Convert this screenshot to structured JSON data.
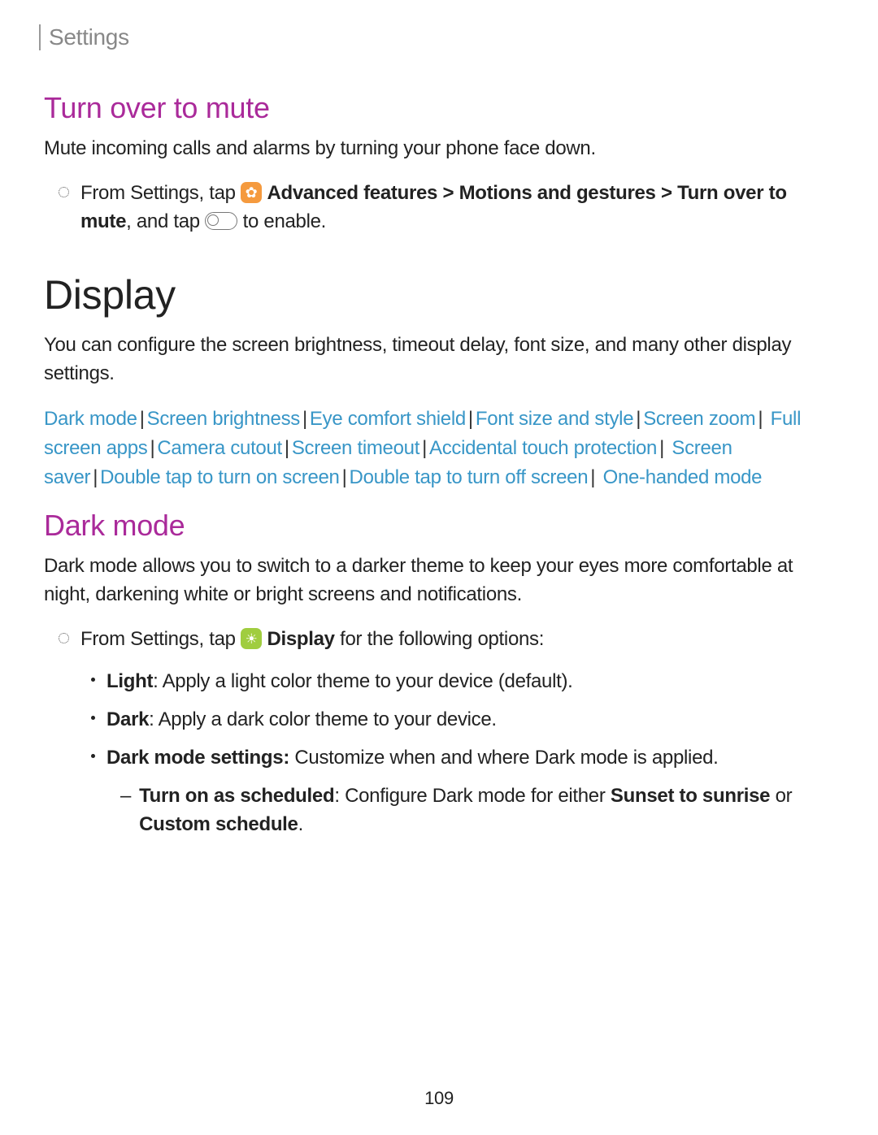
{
  "header": {
    "label": "Settings"
  },
  "turnOver": {
    "heading": "Turn over to mute",
    "description": "Mute incoming calls and alarms by turning your phone face down.",
    "instruction": {
      "prefix": "From Settings, tap",
      "path1": "Advanced features",
      "gt1": ">",
      "path2": "Motions and gestures",
      "gt2": ">",
      "path3": "Turn over to mute",
      "mid": ", and tap",
      "suffix": "to enable."
    }
  },
  "display": {
    "heading": "Display",
    "description": "You can configure the screen brightness, timeout delay, font size, and many other display settings.",
    "links": [
      "Dark mode",
      "Screen brightness",
      "Eye comfort shield",
      "Font size and style",
      "Screen zoom",
      "Full screen apps",
      "Camera cutout",
      "Screen timeout",
      "Accidental touch protection",
      "Screen saver",
      "Double tap to turn on screen",
      "Double tap to turn off screen",
      "One-handed mode"
    ]
  },
  "darkMode": {
    "heading": "Dark mode",
    "description": "Dark mode allows you to switch to a darker theme to keep your eyes more comfortable at night, darkening white or bright screens and notifications.",
    "instruction": {
      "prefix": "From Settings, tap",
      "displayBold": "Display",
      "suffix": "for the following options:"
    },
    "options": {
      "lightLabel": "Light",
      "lightDesc": ": Apply a light color theme to your device (default).",
      "darkLabel": "Dark",
      "darkDesc": ": Apply a dark color theme to your device.",
      "settingsLabel": "Dark mode settings:",
      "settingsDesc": " Customize when and where Dark mode is applied.",
      "scheduleLabel": "Turn on as scheduled",
      "scheduleMid": ": Configure Dark mode for either ",
      "sunset": "Sunset to sunrise",
      "or": " or ",
      "custom": "Custom schedule",
      "period": "."
    }
  },
  "pageNumber": "109"
}
